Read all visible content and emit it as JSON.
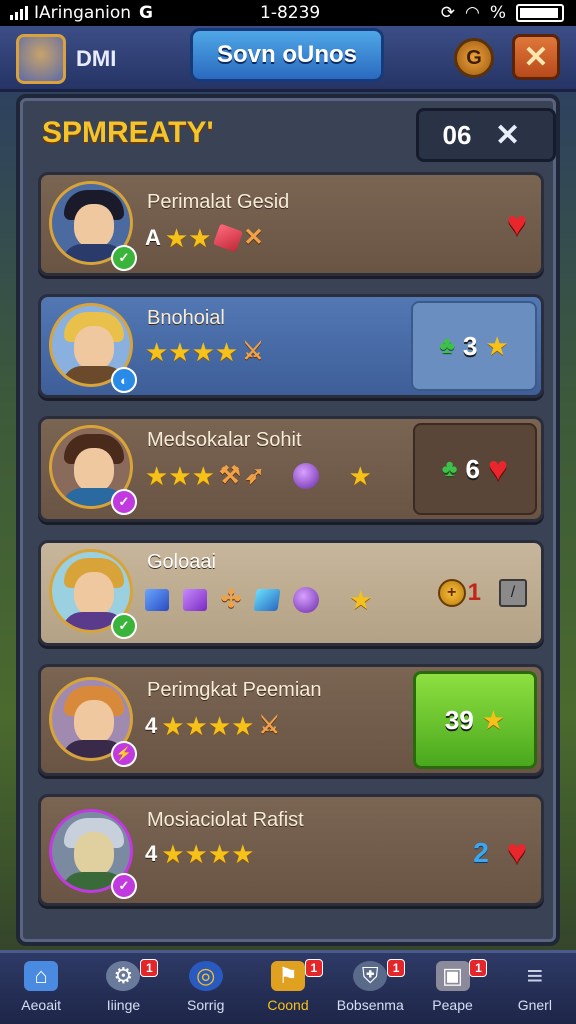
{
  "status_bar": {
    "carrier": "IAringanion",
    "carrier_mark": "G",
    "time": "1-8239",
    "right_text": "%"
  },
  "header": {
    "player_name": "DMI",
    "title": "Sovn oUnos",
    "coin_label": "G",
    "close_label": "✕"
  },
  "panel": {
    "title": "SPMREATY'",
    "counter": "06",
    "close_label": "✕"
  },
  "rows": [
    {
      "name": "Perimalat Gesid",
      "prefix": "A",
      "stars": "★★",
      "side": {
        "type": "plain"
      }
    },
    {
      "name": "Bnohoial",
      "prefix": "",
      "stars": "★★★★",
      "side": {
        "type": "box",
        "value": "3"
      }
    },
    {
      "name": "Medsokalar Sohit",
      "prefix": "",
      "stars": "★★★",
      "side": {
        "type": "box",
        "value": "6"
      }
    },
    {
      "name": "Goloaai",
      "prefix": "",
      "stars": "",
      "side": {
        "type": "plain2",
        "value": "1"
      }
    },
    {
      "name": "Perimgkat Peemian",
      "prefix": "4",
      "stars": "★★★★",
      "side": {
        "type": "green",
        "value": "39"
      }
    },
    {
      "name": "Mosiaciolat Rafist",
      "prefix": "4",
      "stars": "★★★★",
      "side": {
        "type": "plain3",
        "value": "2"
      }
    }
  ],
  "nav": [
    {
      "label": "Aeoait",
      "icon": "home-icon",
      "badge": ""
    },
    {
      "label": "Iiinge",
      "icon": "gear-icon",
      "badge": "1"
    },
    {
      "label": "Sorrig",
      "icon": "ring-icon",
      "badge": ""
    },
    {
      "label": "Coond",
      "icon": "flag-icon",
      "badge": "1"
    },
    {
      "label": "Bobsenma",
      "icon": "shield-icon",
      "badge": "1"
    },
    {
      "label": "Peape",
      "icon": "chest-icon",
      "badge": "1"
    },
    {
      "label": "Gnerl",
      "icon": "menu-icon",
      "badge": ""
    }
  ],
  "colors": {
    "accent_gold": "#f6c21a",
    "panel_bg": "#3a4256",
    "heart": "#e8262c",
    "green_box": "#4aa81e"
  }
}
